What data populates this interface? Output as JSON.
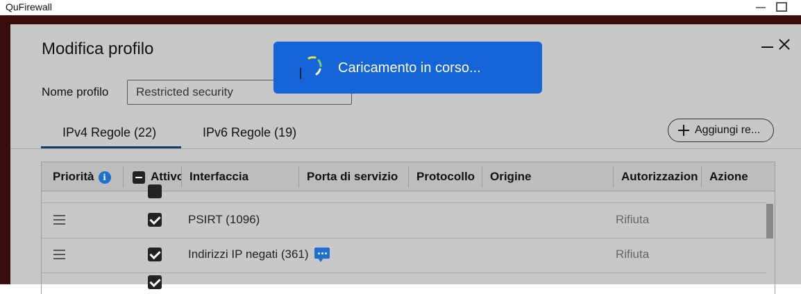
{
  "window": {
    "title": "QuFirewall"
  },
  "modal": {
    "title": "Modifica profilo",
    "profile_name_label": "Nome profilo",
    "profile_name_value": "Restricted security"
  },
  "tabs": [
    {
      "label": "IPv4 Regole (22)",
      "active": true
    },
    {
      "label": "IPv6 Regole (19)",
      "active": false
    }
  ],
  "toolbar": {
    "add_rule_label": "Aggiungi re..."
  },
  "table": {
    "columns": [
      "Priorità",
      "Attivo",
      "Interfaccia",
      "Porta di servizio",
      "Protocollo",
      "Origine",
      "Autorizzazion",
      "Azione"
    ],
    "rows": [
      {
        "name": "PSIRT (1096)",
        "enabled": true,
        "authorization": "Rifiuta",
        "has_comment": false
      },
      {
        "name": "Indirizzi IP negati (361)",
        "enabled": true,
        "authorization": "Rifiuta",
        "has_comment": true
      }
    ]
  },
  "loading": {
    "text": "Caricamento in corso..."
  },
  "colors": {
    "toast_bg": "#1565d8",
    "info_icon": "#1f6fd1",
    "backdrop": "#3a0d0d"
  }
}
